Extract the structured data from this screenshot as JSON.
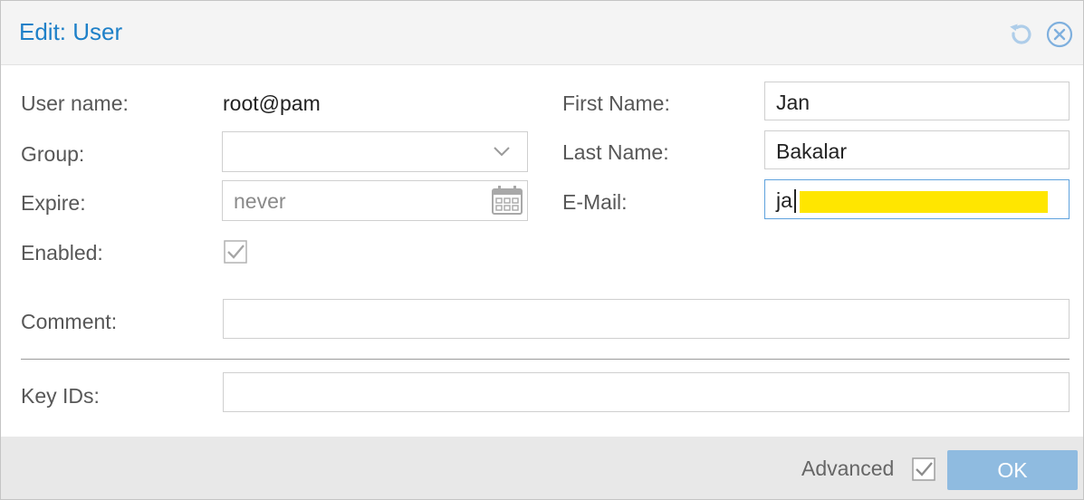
{
  "dialog": {
    "title": "Edit: User",
    "reset_icon": "reset-icon",
    "close_icon": "close-icon"
  },
  "form": {
    "username": {
      "label": "User name:",
      "value": "root@pam"
    },
    "group": {
      "label": "Group:",
      "value": ""
    },
    "expire": {
      "label": "Expire:",
      "placeholder": "never",
      "icon": "calendar-icon"
    },
    "enabled": {
      "label": "Enabled:",
      "checked": true
    },
    "first_name": {
      "label": "First Name:",
      "value": "Jan"
    },
    "last_name": {
      "label": "Last Name:",
      "value": "Bakalar"
    },
    "email": {
      "label": "E-Mail:",
      "value": "ja"
    },
    "comment": {
      "label": "Comment:",
      "value": ""
    },
    "key_ids": {
      "label": "Key IDs:",
      "value": ""
    }
  },
  "footer": {
    "advanced_label": "Advanced",
    "advanced_checked": true,
    "ok_label": "OK"
  },
  "colors": {
    "title": "#1e80c8",
    "ok_button": "#8fbbe0",
    "redaction": "#ffe600"
  }
}
